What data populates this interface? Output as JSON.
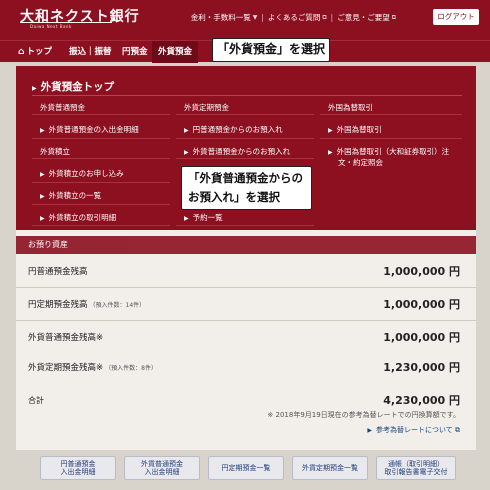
{
  "header": {
    "logo_text": "大和ネクスト銀行",
    "logo_subtext": "Daiwa Next Bank",
    "links": [
      "金利・手数料一覧",
      "よくあるご質問",
      "ご意見・ご要望"
    ],
    "logout_label": "ログアウト"
  },
  "nav": {
    "items": [
      "トップ",
      "振込｜振替",
      "円預金",
      "外貨預金"
    ]
  },
  "callouts": {
    "first": "「外貨預金」を選択",
    "second_line1": "「外貨普通預金からの",
    "second_line2": "お預入れ」を選択"
  },
  "dropdown": {
    "title": "外貨預金トップ",
    "col1": {
      "head1": "外貨普通預金",
      "link1": "外貨普通預金の入出金明細",
      "head2": "外貨積立",
      "link2": "外貨積立のお申し込み",
      "link3": "外貨積立の一覧",
      "link4": "外貨積立の取引明細"
    },
    "col2": {
      "head1": "外貨定期預金",
      "link1": "円普通預金からのお預入れ",
      "link2": "外貨普通預金からのお預入れ",
      "link3": "予約一覧"
    },
    "col3": {
      "head1": "外国為替取引",
      "link1": "外国為替取引",
      "link2_line1": "外国為替取引（大和証券取引）注",
      "link2_line2": "文・約定照会"
    }
  },
  "main": {
    "section_title": "お預り資産",
    "rows": [
      {
        "label": "円普通預金残高",
        "note": "",
        "value": "1,000,000 円"
      },
      {
        "label": "円定期預金残高",
        "note": "（預入件数：14件）",
        "value": "1,000,000 円"
      },
      {
        "label": "外貨普通預金残高※",
        "note": "",
        "value": "1,000,000 円"
      },
      {
        "label": "外貨定期預金残高※",
        "note": "（預入件数：8件）",
        "value": "1,230,000 円"
      }
    ],
    "total_label": "合計",
    "total_value": "4,230,000 円",
    "total_note": "※ 2018年9月19日現在の参考為替レートでの円換算額です。",
    "ref_link": "参考為替レートについて"
  },
  "buttons": [
    {
      "line1": "円普通預金",
      "line2": "入出金明細"
    },
    {
      "line1": "外貨普通預金",
      "line2": "入出金明細"
    },
    {
      "line1": "円定期預金一覧",
      "line2": ""
    },
    {
      "line1": "外貨定期預金一覧",
      "line2": ""
    },
    {
      "line1": "通帳（取引明細）",
      "line2": "取引報告書電子交付"
    }
  ],
  "colors": {
    "brand": "#8c1020",
    "page_bg": "#d8d3cb",
    "card_bg": "#f2efea",
    "link": "#16457a"
  }
}
